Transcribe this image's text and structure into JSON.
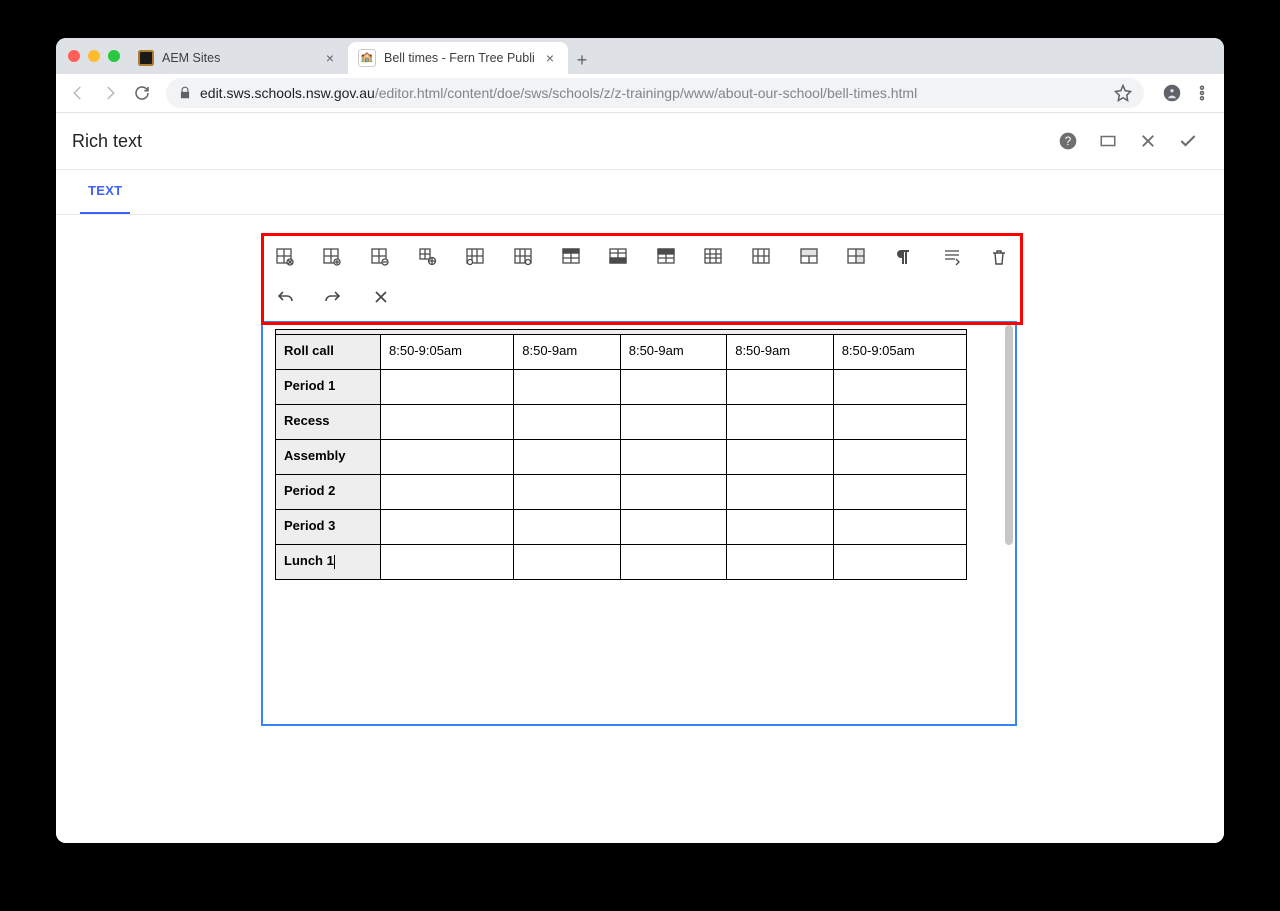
{
  "browser": {
    "tabs": [
      {
        "title": "AEM Sites",
        "active": false
      },
      {
        "title": "Bell times - Fern Tree Public Sc",
        "active": true
      }
    ],
    "url_host": "edit.sws.schools.nsw.gov.au",
    "url_path": "/editor.html/content/doe/sws/schools/z/z-trainingp/www/about-our-school/bell-times.html"
  },
  "dialog": {
    "title": "Rich text",
    "tab_label": "TEXT"
  },
  "toolbar": {
    "row1": [
      "table-cut",
      "table-add",
      "table-remove",
      "cell-props",
      "insert-col-before",
      "insert-col-after",
      "insert-row-above",
      "insert-row-below",
      "header-row",
      "delete-row",
      "delete-column",
      "merge-cells",
      "split-cell",
      "paragraph-format",
      "edit-source",
      "delete"
    ],
    "row2": [
      "undo",
      "redo",
      "close"
    ]
  },
  "table": {
    "rows": [
      {
        "label": "Roll call",
        "cells": [
          "8:50-9:05am",
          "8:50-9am",
          "8:50-9am",
          "8:50-9am",
          "8:50-9:05am"
        ]
      },
      {
        "label": "Period 1",
        "cells": [
          "",
          "",
          "",
          "",
          ""
        ]
      },
      {
        "label": "Recess",
        "cells": [
          "",
          "",
          "",
          "",
          ""
        ]
      },
      {
        "label": "Assembly",
        "cells": [
          "",
          "",
          "",
          "",
          ""
        ]
      },
      {
        "label": "Period 2",
        "cells": [
          "",
          "",
          "",
          "",
          ""
        ]
      },
      {
        "label": "Period 3",
        "cells": [
          "",
          "",
          "",
          "",
          ""
        ]
      },
      {
        "label": "Lunch 1",
        "cells": [
          "",
          "",
          "",
          "",
          ""
        ]
      }
    ]
  }
}
